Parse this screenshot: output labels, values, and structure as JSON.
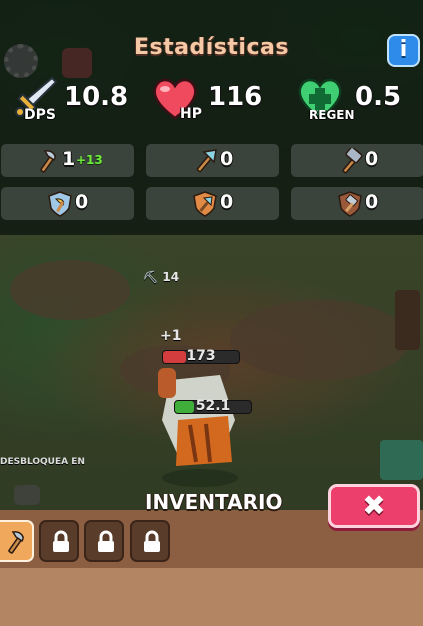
{
  "stats": {
    "title": "Estadísticas",
    "info_label": "i",
    "dps": {
      "value": "10.8",
      "tag": "DPS"
    },
    "hp": {
      "value": "116",
      "tag": "HP"
    },
    "regen": {
      "value": "0.5",
      "tag": "REGEN"
    },
    "rows": [
      [
        {
          "icon": "axe-icon",
          "value": "1",
          "bonus": "+13"
        },
        {
          "icon": "pickaxe-icon",
          "value": "0"
        },
        {
          "icon": "hammer-icon",
          "value": "0"
        }
      ],
      [
        {
          "icon": "axe-shield-icon",
          "value": "0"
        },
        {
          "icon": "pickaxe-shield-icon",
          "value": "0"
        },
        {
          "icon": "hammer-shield-icon",
          "value": "0"
        }
      ]
    ]
  },
  "world": {
    "pickaxe_level": "14",
    "plus_one": "+1",
    "enemy_hp": "173",
    "player_hp": "52.1",
    "unlock_text": "DESBLOQUEA EN"
  },
  "inventory": {
    "title": "INVENTARIO",
    "close_label": "✖",
    "slots": [
      "axe-icon",
      "lock-icon",
      "lock-icon",
      "lock-icon"
    ]
  },
  "colors": {
    "accent_close": "#ec3f6c",
    "info_blue": "#2f8bea",
    "bonus_green": "#6dea3a",
    "inventory_brown": "#b38562"
  }
}
